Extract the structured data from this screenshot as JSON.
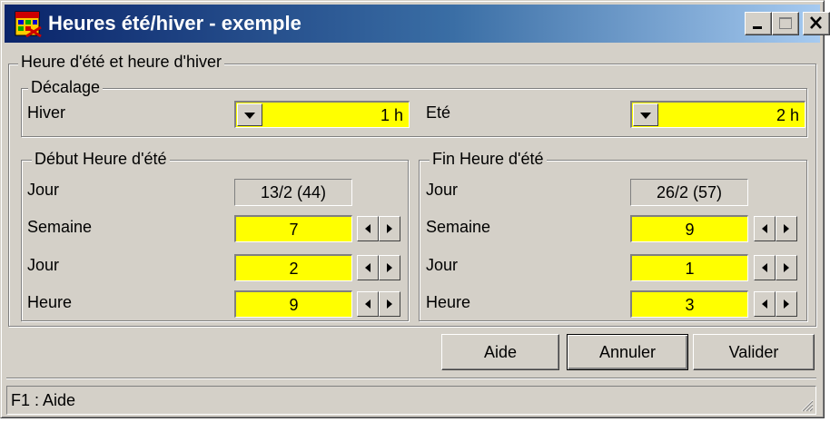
{
  "window": {
    "title": "Heures été/hiver - exemple",
    "icon": "app-grid-icon"
  },
  "titlebar_buttons": {
    "minimize": "minimize-icon",
    "maximize": "maximize-icon",
    "close": "close-icon"
  },
  "outer_group": {
    "label": "Heure d'été et heure d'hiver"
  },
  "decalage": {
    "label": "Décalage",
    "hiver": {
      "label": "Hiver",
      "value": "1 h"
    },
    "ete": {
      "label": "Eté",
      "value": "2 h"
    }
  },
  "debut": {
    "label": "Début Heure d'été",
    "jour_label": "Jour",
    "jour_value": "13/2 (44)",
    "semaine_label": "Semaine",
    "semaine_value": "7",
    "jour2_label": "Jour",
    "jour2_value": "2",
    "heure_label": "Heure",
    "heure_value": "9"
  },
  "fin": {
    "label": "Fin Heure d'été",
    "jour_label": "Jour",
    "jour_value": "26/2 (57)",
    "semaine_label": "Semaine",
    "semaine_value": "9",
    "jour2_label": "Jour",
    "jour2_value": "1",
    "heure_label": "Heure",
    "heure_value": "3"
  },
  "buttons": {
    "aide": "Aide",
    "annuler": "Annuler",
    "valider": "Valider"
  },
  "status": {
    "text": "F1 : Aide"
  },
  "colors": {
    "field_bg": "#ffff00",
    "titlebar_start": "#0a246a",
    "titlebar_end": "#a6caf0",
    "face": "#d4d0c8"
  }
}
